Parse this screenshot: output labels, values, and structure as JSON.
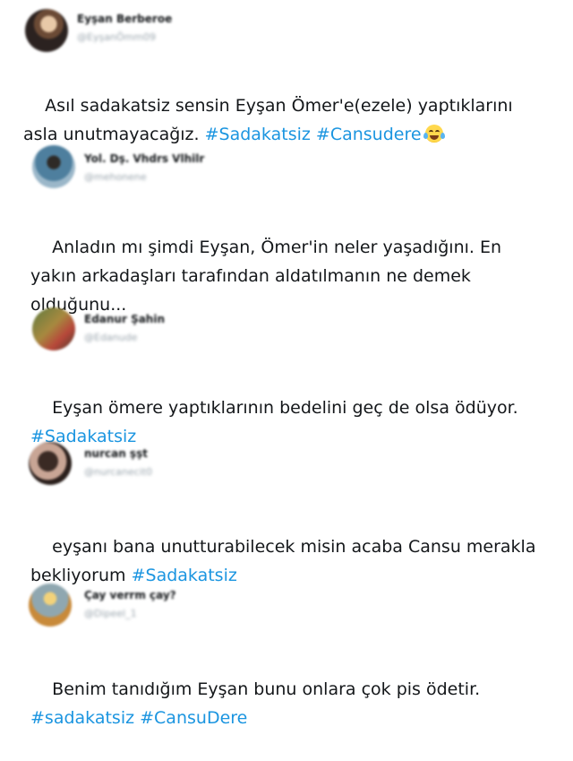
{
  "tweets": [
    {
      "name": "Eyşan Berberoe",
      "handle": "@EyşanÖmm09",
      "text_segments": [
        {
          "text": "Asıl sadakatsiz sensin Eyşan Ömer'e(ezele) yaptıklarını\nasla unutmayacağız. ",
          "type": "text"
        },
        {
          "text": "#Sadakatsiz",
          "type": "tag"
        },
        {
          "text": " ",
          "type": "text"
        },
        {
          "text": "#Cansudere",
          "type": "tag"
        }
      ],
      "emoji": "face-with-tears-of-joy-icon"
    },
    {
      "name": "Yol. Dş. Vhdrs Vlhilr",
      "handle": "@mehonene",
      "text_segments": [
        {
          "text": "Anladın mı şimdi Eyşan, Ömer'in neler yaşadığını. En\nyakın arkadaşları tarafından aldatılmanın ne demek\nolduğunu...",
          "type": "text"
        }
      ]
    },
    {
      "name": "Edanur Şahin",
      "handle": "@Edanude",
      "text_segments": [
        {
          "text": "Eyşan ömere yaptıklarının bedelini geç de olsa ödüyor.\n",
          "type": "text"
        },
        {
          "text": "#Sadakatsiz",
          "type": "tag"
        }
      ]
    },
    {
      "name": "nurcan şşt",
      "handle": "@nurcanecit0",
      "text_segments": [
        {
          "text": "eyşanı bana unutturabilecek misin acaba Cansu merakla\nbekliyorum ",
          "type": "text"
        },
        {
          "text": "#Sadakatsiz",
          "type": "tag"
        }
      ]
    },
    {
      "name": "Çay verrm çay?",
      "handle": "@Dipeel_1",
      "text_segments": [
        {
          "text": "Benim tanıdığım Eyşan bunu onlara çok pis ödetir.\n",
          "type": "text"
        },
        {
          "text": "#sadakatsiz",
          "type": "tag"
        },
        {
          "text": " ",
          "type": "text"
        },
        {
          "text": "#CansuDere",
          "type": "tag"
        }
      ]
    }
  ]
}
